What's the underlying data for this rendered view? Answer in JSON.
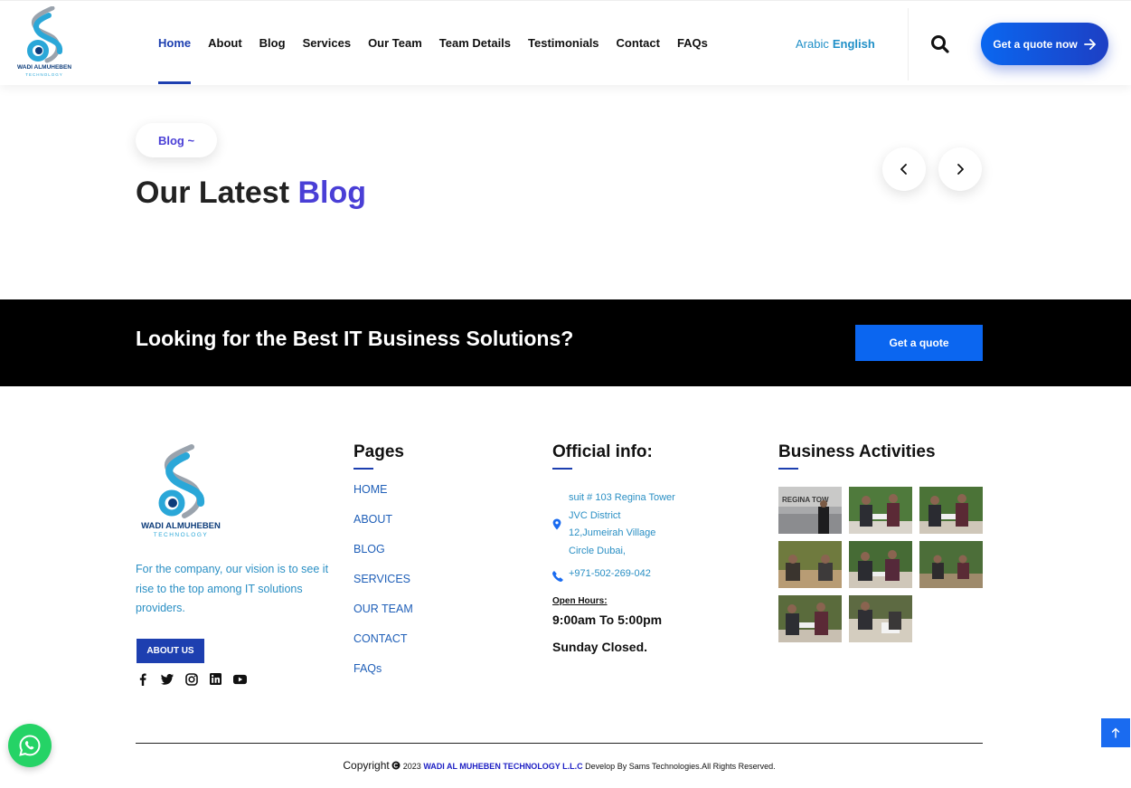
{
  "brand": {
    "name": "WADI ALMUHEBEN",
    "sub": "TECHNOLOGY",
    "accent": "#1d3fb0",
    "purple": "#4a3fd6",
    "blue": "#0b66f0"
  },
  "nav": {
    "items": [
      "Home",
      "About",
      "Blog",
      "Services",
      "Our Team",
      "Team Details",
      "Testimonials",
      "Contact",
      "FAQs"
    ],
    "active": "Home"
  },
  "header": {
    "lang_arabic": "Arabic",
    "lang_english": "English",
    "search_icon": "search-icon",
    "quote_label": "Get a quote now"
  },
  "blog": {
    "badge": "Blog ~",
    "title_main": "Our Latest",
    "title_accent": "Blog"
  },
  "cta": {
    "text": "Looking for the Best IT Business Solutions?",
    "button": "Get a quote"
  },
  "footer": {
    "vision": "For the company, our vision is to see it rise to the top among IT solutions providers.",
    "about_button": "ABOUT US",
    "social": [
      "facebook-icon",
      "twitter-icon",
      "instagram-icon",
      "linkedin-icon",
      "youtube-icon"
    ],
    "pages_heading": "Pages",
    "pages": [
      "HOME",
      "ABOUT",
      "BLOG",
      "SERVICES",
      "OUR TEAM",
      "CONTACT",
      "FAQs"
    ],
    "info_heading": "Official info:",
    "address": "suit # 103 Regina Tower JVC District 12,Jumeirah Village Circle Dubai,",
    "phone": "+971-502-269-042",
    "hours_label": "Open Hours:",
    "hours_time": "9:00am To 5:00pm",
    "hours_closed": "Sunday Closed.",
    "activities_heading": "Business Activities",
    "gallery_first_caption": "REGINA TOW",
    "copyright_prefix": "Copyright",
    "copyright_year": "2023",
    "copyright_company": "WADI AL MUHEBEN TECHNOLOGY L.L.C",
    "copyright_suffix": "Develop By Sams Technologies.All Rights Reserved."
  }
}
